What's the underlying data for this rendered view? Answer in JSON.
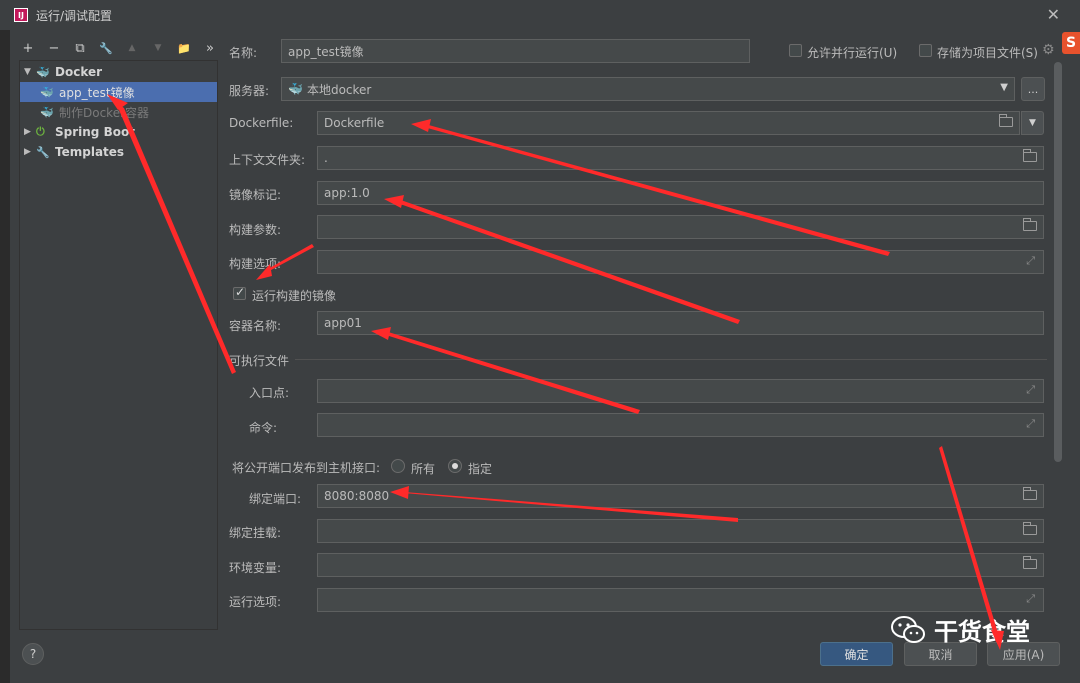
{
  "window": {
    "title": "运行/调试配置",
    "app_badge": "IJ"
  },
  "toolbar": {
    "icons": [
      "plus-icon",
      "minus-icon",
      "copy-icon",
      "wrench-icon",
      "arrow-up-icon",
      "arrow-down-icon",
      "folder-add-icon",
      "more-icon"
    ],
    "more_label": "»",
    "plus": "+",
    "minus": "−",
    "copy": "⧉",
    "wrench": "🔧",
    "up": "▲",
    "down": "▼",
    "folder": "📁"
  },
  "tree": {
    "docker": "Docker",
    "app_test": "app_test镜像",
    "make_container": "制作Docker容器",
    "spring_boot": "Spring Boot",
    "templates": "Templates"
  },
  "form": {
    "name_label": "名称:",
    "name_value": "app_test镜像",
    "allow_parallel_label": "允许并行运行(U)",
    "store_as_project_label": "存储为项目文件(S)",
    "server_label": "服务器:",
    "server_value": "本地docker",
    "server_more": "...",
    "dockerfile_label": "Dockerfile:",
    "dockerfile_value": "Dockerfile",
    "context_label": "上下文文件夹:",
    "context_value": ".",
    "image_tag_label": "镜像标记:",
    "image_tag_value": "app:1.0",
    "build_args_label": "构建参数:",
    "build_args_value": "",
    "build_options_label": "构建选项:",
    "build_options_value": "",
    "run_built_label": "运行构建的镜像",
    "container_name_label": "容器名称:",
    "container_name_value": "app01",
    "executable_section": "可执行文件",
    "entrypoint_label": "入口点:",
    "entrypoint_value": "",
    "command_label": "命令:",
    "command_value": "",
    "publish_ports_label": "将公开端口发布到主机接口:",
    "radio_all": "所有",
    "radio_specified": "指定",
    "bind_ports_label": "绑定端口:",
    "bind_ports_value": "8080:8080",
    "bind_mounts_label": "绑定挂载:",
    "bind_mounts_value": "",
    "env_label": "环境变量:",
    "env_value": "",
    "run_options_label": "运行选项:",
    "run_options_value": ""
  },
  "buttons": {
    "ok": "确定",
    "cancel": "取消",
    "apply": "应用(A)",
    "help": "?"
  },
  "watermark": {
    "text": "干货食堂"
  },
  "sogou": {
    "text": "S"
  },
  "colors": {
    "accent": "#4b6eaf",
    "ok_button": "#365880",
    "arrow": "#ff2a2a"
  }
}
